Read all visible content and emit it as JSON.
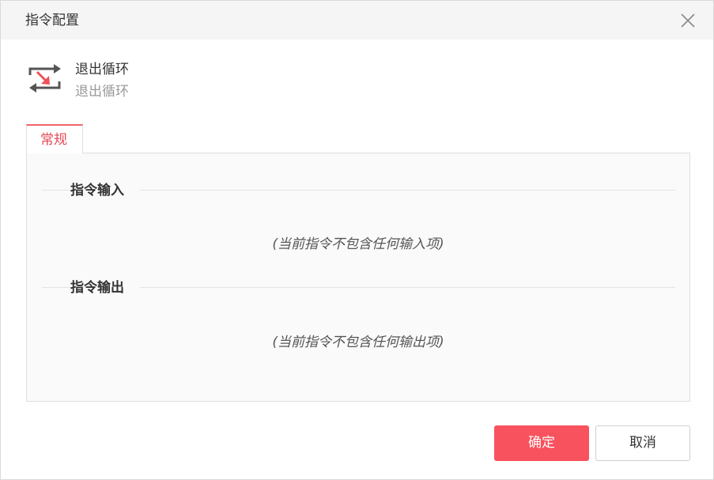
{
  "dialog": {
    "title": "指令配置",
    "close_icon": "close-icon"
  },
  "command": {
    "icon": "loop-exit-icon",
    "name": "退出循环",
    "description": "退出循环"
  },
  "tabs": [
    {
      "label": "常规",
      "active": true
    }
  ],
  "sections": {
    "input": {
      "title": "指令输入",
      "empty_text": "(当前指令不包含任何输入项)"
    },
    "output": {
      "title": "指令输出",
      "empty_text": "(当前指令不包含任何输出项)"
    }
  },
  "buttons": {
    "ok_label": "确定",
    "cancel_label": "取消"
  },
  "colors": {
    "accent": "#f7525d",
    "tab_active_text": "#e64a55",
    "header_bg": "#f5f5f5",
    "icon_gray": "#555555",
    "icon_red": "#f0505a"
  }
}
